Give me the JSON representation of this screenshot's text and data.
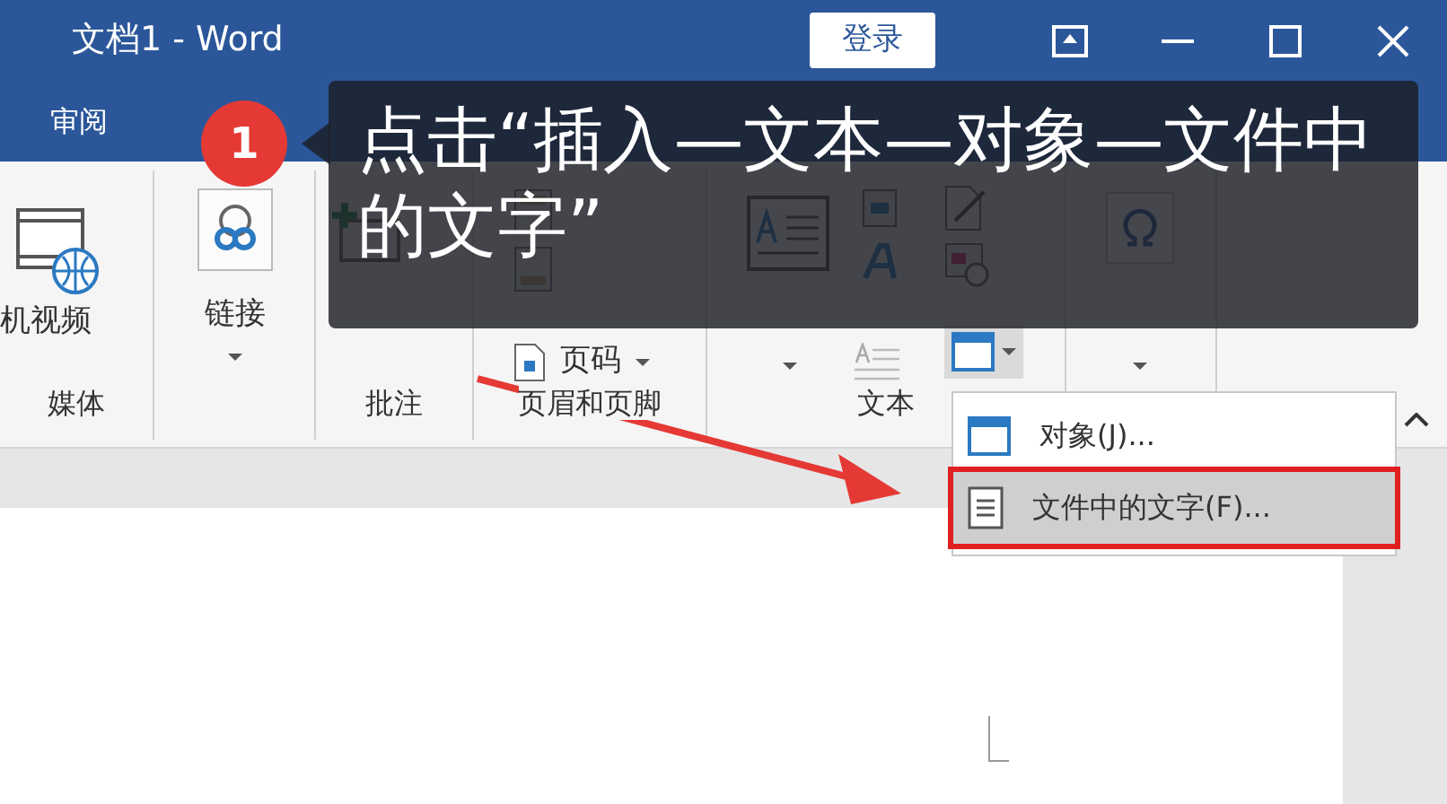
{
  "title_bar": {
    "title": "文档1 - Word",
    "login_button": "登录"
  },
  "ribbon_tabs": [
    {
      "label": "审阅",
      "selected": false
    }
  ],
  "ribbon": {
    "media_button": "机视频",
    "media_group": "媒体",
    "link_button": "链接",
    "comment_group": "批注",
    "page_number_button": "页码",
    "header_footer_group": "页眉和页脚",
    "text_group": "文本"
  },
  "dropdown_menu": [
    {
      "label": "对象(J)...",
      "selected": false
    },
    {
      "label": "文件中的文字(F)...",
      "selected": true
    }
  ],
  "callout": {
    "step": "1",
    "text": "点击“插入—文本—对象—文件中的文字”"
  }
}
